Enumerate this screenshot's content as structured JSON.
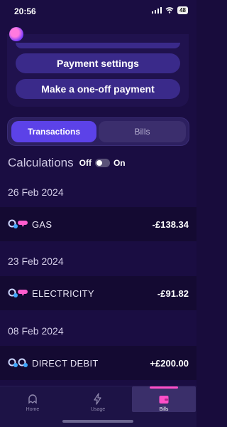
{
  "status_bar": {
    "time": "20:56",
    "battery": "48"
  },
  "actions": {
    "payment_settings": "Payment settings",
    "one_off_payment": "Make a one-off payment"
  },
  "tabs": {
    "transactions": "Transactions",
    "bills": "Bills"
  },
  "calculations": {
    "title": "Calculations",
    "off": "Off",
    "on": "On"
  },
  "groups": [
    {
      "date": "26 Feb 2024",
      "name": "GAS",
      "amount": "-£138.34"
    },
    {
      "date": "23 Feb 2024",
      "name": "ELECTRICITY",
      "amount": "-£91.82"
    },
    {
      "date": "08 Feb 2024",
      "name": "DIRECT DEBIT",
      "amount": "+£200.00"
    }
  ],
  "nav": {
    "home": "Home",
    "usage": "Usage",
    "bills": "Bills"
  },
  "colors": {
    "accent": "#5c42e8",
    "highlight": "#ff4fc8",
    "background": "#1a0d42"
  }
}
